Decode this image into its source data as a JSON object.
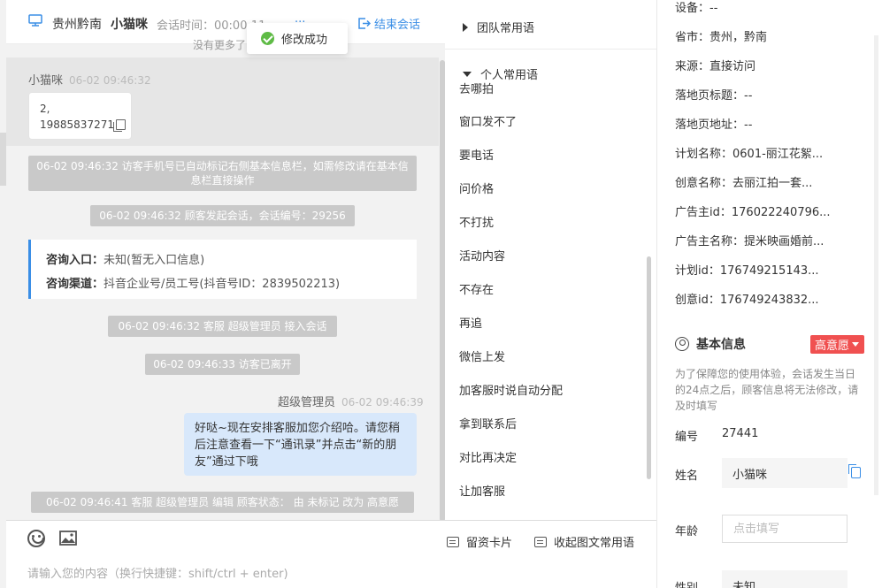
{
  "chat": {
    "header": {
      "region": "贵州黔南",
      "customer_name": "小猫咪",
      "session_time": "会话时间：00:00:11",
      "hidden_text": "...",
      "end_label": "结束会话"
    },
    "no_more": "没有更多了",
    "toast": "修改成功",
    "visitor_msg": {
      "name": "小猫咪",
      "time": "06-02 09:46:32",
      "line1": "2,",
      "line2": "19885837271"
    },
    "sys1": "06-02 09:46:32 访客手机号已自动标记右侧基本信息栏，如需修改请在基本信息栏直接操作",
    "sys2": "06-02 09:46:32 顾客发起会话，会话编号：29256",
    "consult": {
      "entry_key": "咨询入口：",
      "entry_val": "未知(暂无入口信息)",
      "channel_key": "咨询渠道：",
      "channel_val": "抖音企业号/员工号(抖音号ID：2839502213)"
    },
    "sys3": "06-02 09:46:32 客服 超级管理员 接入会话",
    "sys4": "06-02 09:46:33 访客已离开",
    "agent_msg": {
      "name": "超级管理员",
      "time": "06-02 09:46:39",
      "text": "好哒~现在安排客服加您介绍哈。请您稍后注意查看一下“通讯录”并点击“新的朋友”通过下哦"
    },
    "sys5": "06-02 09:46:41 客服 超级管理员 编辑 顾客状态： 由 未标记 改为 高意愿",
    "input_placeholder": "请输入您的内容（换行快捷键：shift/ctrl + enter)"
  },
  "phrases": {
    "team_group": "团队常用语",
    "personal_group": "个人常用语",
    "items": [
      "去哪拍",
      "窗口发不了",
      "要电话",
      "问价格",
      "不打扰",
      "活动内容",
      "不存在",
      "再追",
      "微信上发",
      "加客服时说自动分配",
      "拿到联系后",
      "对比再决定",
      "让加客服"
    ],
    "leave_card": "留资卡片",
    "collapse": "收起图文常用语"
  },
  "info": {
    "rows": [
      {
        "label": "设备：",
        "value": "--"
      },
      {
        "label": "省市：",
        "value": "贵州，黔南"
      },
      {
        "label": "来源：",
        "value": "直接访问"
      },
      {
        "label": "落地页标题：",
        "value": "--"
      },
      {
        "label": "落地页地址：",
        "value": "--"
      },
      {
        "label": "计划名称：",
        "value": "0601-丽江花絮..."
      },
      {
        "label": "创意名称：",
        "value": "去丽江拍一套..."
      },
      {
        "label": "广告主id：",
        "value": "176022240796..."
      },
      {
        "label": "广告主名称：",
        "value": "提米映画婚前..."
      },
      {
        "label": "计划id：",
        "value": "176749215143..."
      },
      {
        "label": "创意id：",
        "value": "176749243832..."
      }
    ],
    "basic_title": "基本信息",
    "intent_badge": "高意愿",
    "notice": "为了保障您的使用体验，会话发生当日的24点之后，顾客信息将无法修改，请及时填写",
    "form": {
      "id_label": "编号",
      "id_value": "27441",
      "name_label": "姓名",
      "name_value": "小猫咪",
      "age_label": "年龄",
      "age_placeholder": "点击填写",
      "gender_label": "性别",
      "gender_value": "未知"
    }
  },
  "colors": {
    "accent": "#3a8ee6",
    "agent_bubble": "#d8e8fb",
    "system_msg": "#c9c9c9",
    "badge_red": "#f05050",
    "toast_green": "#5fbb46"
  }
}
